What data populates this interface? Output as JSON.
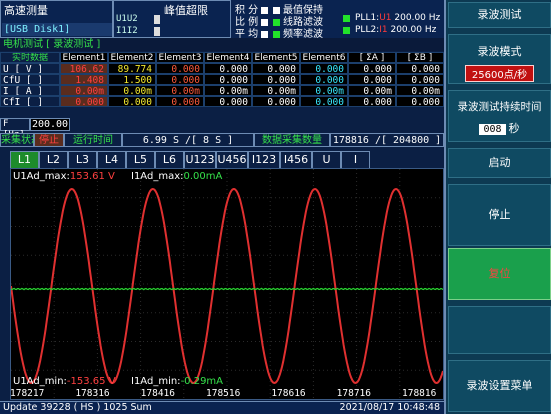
{
  "top": {
    "mode_title": "高速测量",
    "mode_storage": "[USB Disk1]",
    "range_title": "峰值超限",
    "range_u": "U1U2",
    "range_i": "I1I2",
    "flags": [
      {
        "label": "积 分",
        "state": "off"
      },
      {
        "label": "比 例",
        "state": "off"
      },
      {
        "label": "平 均",
        "state": "off"
      },
      {
        "label": "最值保持",
        "state": "off"
      },
      {
        "label": "线路滤波",
        "state": "on"
      },
      {
        "label": "频率滤波",
        "state": "on"
      }
    ],
    "pll1_label": "PLL1:",
    "pll1_src": "U1",
    "pll1_value": "200.00 Hz",
    "pll2_label": "PLL2:",
    "pll2_src": "I1",
    "pll2_value": "200.00 Hz"
  },
  "meas": {
    "title": "电机测试 [ 录波测试 ]",
    "headers": [
      "实时数据",
      "Element1",
      "Element2",
      "Element3",
      "Element4",
      "Element5",
      "Element6",
      "[ ΣA ]",
      "[ ΣB ]"
    ],
    "rows": [
      {
        "label": "U  [  V ]",
        "values": [
          "106.62",
          "89.774",
          "0.000",
          "0.000",
          "0.000",
          "0.000",
          "0.000",
          "0.000"
        ]
      },
      {
        "label": "CfU [   ]",
        "values": [
          "1.408",
          "1.500",
          "0.000",
          "0.000",
          "0.000",
          "0.000",
          "0.000",
          "0.000"
        ]
      },
      {
        "label": "I  [  A ]",
        "values": [
          "0.00m",
          "0.00m",
          "0.00m",
          "0.00m",
          "0.00m",
          "0.00m",
          "0.00m",
          "0.00m"
        ]
      },
      {
        "label": "CfI [   ]",
        "values": [
          "0.000",
          "0.000",
          "0.000",
          "0.000",
          "0.000",
          "0.000",
          "0.000",
          "0.000"
        ]
      }
    ],
    "freq_label": "F  [Hz]",
    "freq_value": "200.00"
  },
  "status": {
    "state_label": "采集状态",
    "state_value": "停止",
    "runtime_label": "运行时间",
    "runtime_value": "6.99 S /[ 8 S ]",
    "count_label": "数据采集数量",
    "count_value": "178816 /[ 204800 ]"
  },
  "tabs": [
    "L1",
    "L2",
    "L3",
    "L4",
    "L5",
    "L6",
    "U123",
    "U456",
    "I123",
    "I456",
    "U",
    "I"
  ],
  "active_tab": "L1",
  "wave": {
    "u_max_label": "U1Ad_max:",
    "u_max_value": "153.61 V",
    "i_max_label": "I1Ad_max:",
    "i_max_value": "0.00mA",
    "u_min_label": "U1Ad_min:",
    "u_min_value": "-153.65 V",
    "i_min_label": "I1Ad_min:",
    "i_min_value": "-0.29mA",
    "x_ticks": [
      "178217",
      "178316",
      "178416",
      "178516",
      "178616",
      "178716",
      "178816"
    ]
  },
  "chart_data": {
    "type": "line",
    "title": "",
    "xlabel": "",
    "ylabel": "",
    "x_range": [
      178217,
      178816
    ],
    "series": [
      {
        "name": "U1Ad",
        "color": "#e03030",
        "amplitude": 153.6,
        "cycles": 5.33,
        "phase_deg": 180,
        "unit": "V"
      },
      {
        "name": "I1Ad",
        "color": "#28d830",
        "amplitude": 0.0003,
        "cycles": 0,
        "phase_deg": 0,
        "unit": "mA"
      }
    ],
    "grid": true
  },
  "bottom": {
    "left": "Update  39228 ( HS ) 1025 Sum",
    "right": "2021/08/17  10:48:48"
  },
  "softkeys": {
    "title": "录波测试",
    "mode_label": "录波模式",
    "mode_value": "25600点/秒",
    "duration_label": "录波测试持续时间",
    "duration_value": "008",
    "duration_unit": "秒",
    "start": "启动",
    "stop": "停止",
    "reset": "复位",
    "menu": "录波设置菜单"
  },
  "colors": {
    "accent_green": "#35e04a",
    "voltage_red": "#e03030",
    "current_green": "#28d830",
    "highlight_key": "#1aa04c"
  }
}
